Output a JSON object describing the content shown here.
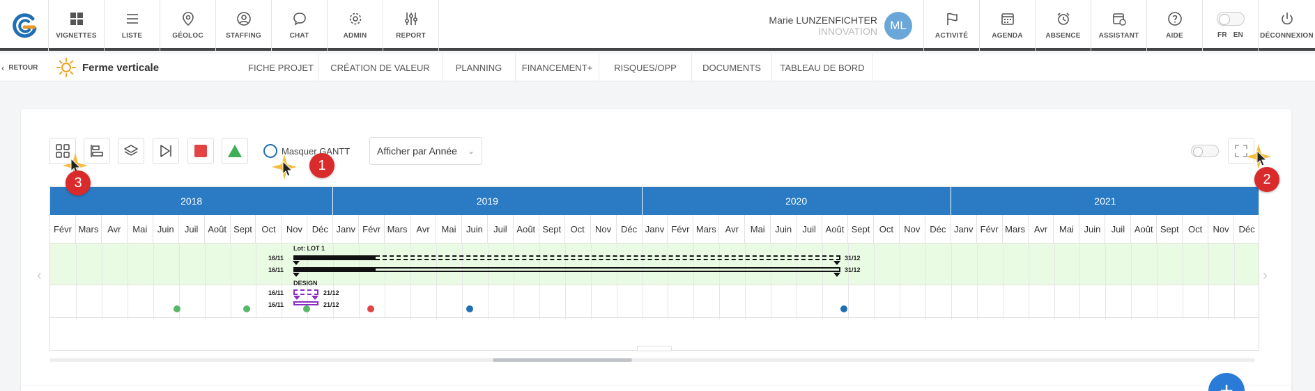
{
  "nav": {
    "items": [
      {
        "label": "VIGNETTES",
        "icon": "grid-icon"
      },
      {
        "label": "LISTE",
        "icon": "list-icon"
      },
      {
        "label": "GÉOLOC",
        "icon": "location-pin-icon"
      },
      {
        "label": "STAFFING",
        "icon": "user-circle-icon"
      },
      {
        "label": "CHAT",
        "icon": "chat-bubble-icon"
      },
      {
        "label": "ADMIN",
        "icon": "gear-icon"
      },
      {
        "label": "REPORT",
        "icon": "sliders-icon"
      }
    ],
    "right_items": [
      {
        "label": "ACTIVITÉ",
        "icon": "flag-icon"
      },
      {
        "label": "AGENDA",
        "icon": "calendar-icon"
      },
      {
        "label": "ABSENCE",
        "icon": "alarm-clock-icon"
      },
      {
        "label": "ASSISTANT",
        "icon": "calendar-clock-icon"
      },
      {
        "label": "AIDE",
        "icon": "help-circle-icon"
      }
    ],
    "lang": {
      "fr": "FR",
      "en": "EN"
    },
    "logout": "DÉCONNEXION"
  },
  "user": {
    "name": "Marie LUNZENFICHTER",
    "org": "INNOVATION",
    "initials": "ML"
  },
  "subbar": {
    "back": "RETOUR",
    "project": "Ferme verticale",
    "tabs": [
      "FICHE PROJET",
      "CRÉATION DE VALEUR",
      "PLANNING",
      "FINANCEMENT+",
      "RISQUES/OPP",
      "DOCUMENTS",
      "TABLEAU DE BORD"
    ]
  },
  "toolbar": {
    "masquer_label": "Masquer GANTT",
    "select_value": "Afficher par Année"
  },
  "gantt": {
    "years": [
      "2018",
      "2019",
      "2020",
      "2021"
    ],
    "months": [
      "Févr",
      "Mars",
      "Avr",
      "Mai",
      "Juin",
      "Juil",
      "Août",
      "Sept",
      "Oct",
      "Nov",
      "Déc",
      "Janv",
      "Févr",
      "Mars",
      "Avr",
      "Mai",
      "Juin",
      "Juil",
      "Août",
      "Sept",
      "Oct",
      "Nov",
      "Déc",
      "Janv",
      "Févr",
      "Mars",
      "Avr",
      "Mai",
      "Juin",
      "Juil",
      "Août",
      "Sept",
      "Oct",
      "Nov",
      "Déc",
      "Janv",
      "Févr",
      "Mars",
      "Avr",
      "Mai",
      "Juin",
      "Juil",
      "Août",
      "Sept",
      "Oct",
      "Nov",
      "Déc"
    ],
    "lot_label": "Lot: LOT 1",
    "lot_start_1": "16/11",
    "lot_end_1": "31/12",
    "lot_start_2": "16/11",
    "lot_end_2": "31/12",
    "design_label": "DESIGN",
    "design_start_1": "16/11",
    "design_end_1": "21/12",
    "design_start_2": "16/11",
    "design_end_2": "21/12",
    "colors": {
      "header": "#2a7bc4",
      "band": "#eafbe4",
      "design": "#8a2bc8"
    }
  },
  "callouts": [
    "1",
    "2",
    "3"
  ]
}
